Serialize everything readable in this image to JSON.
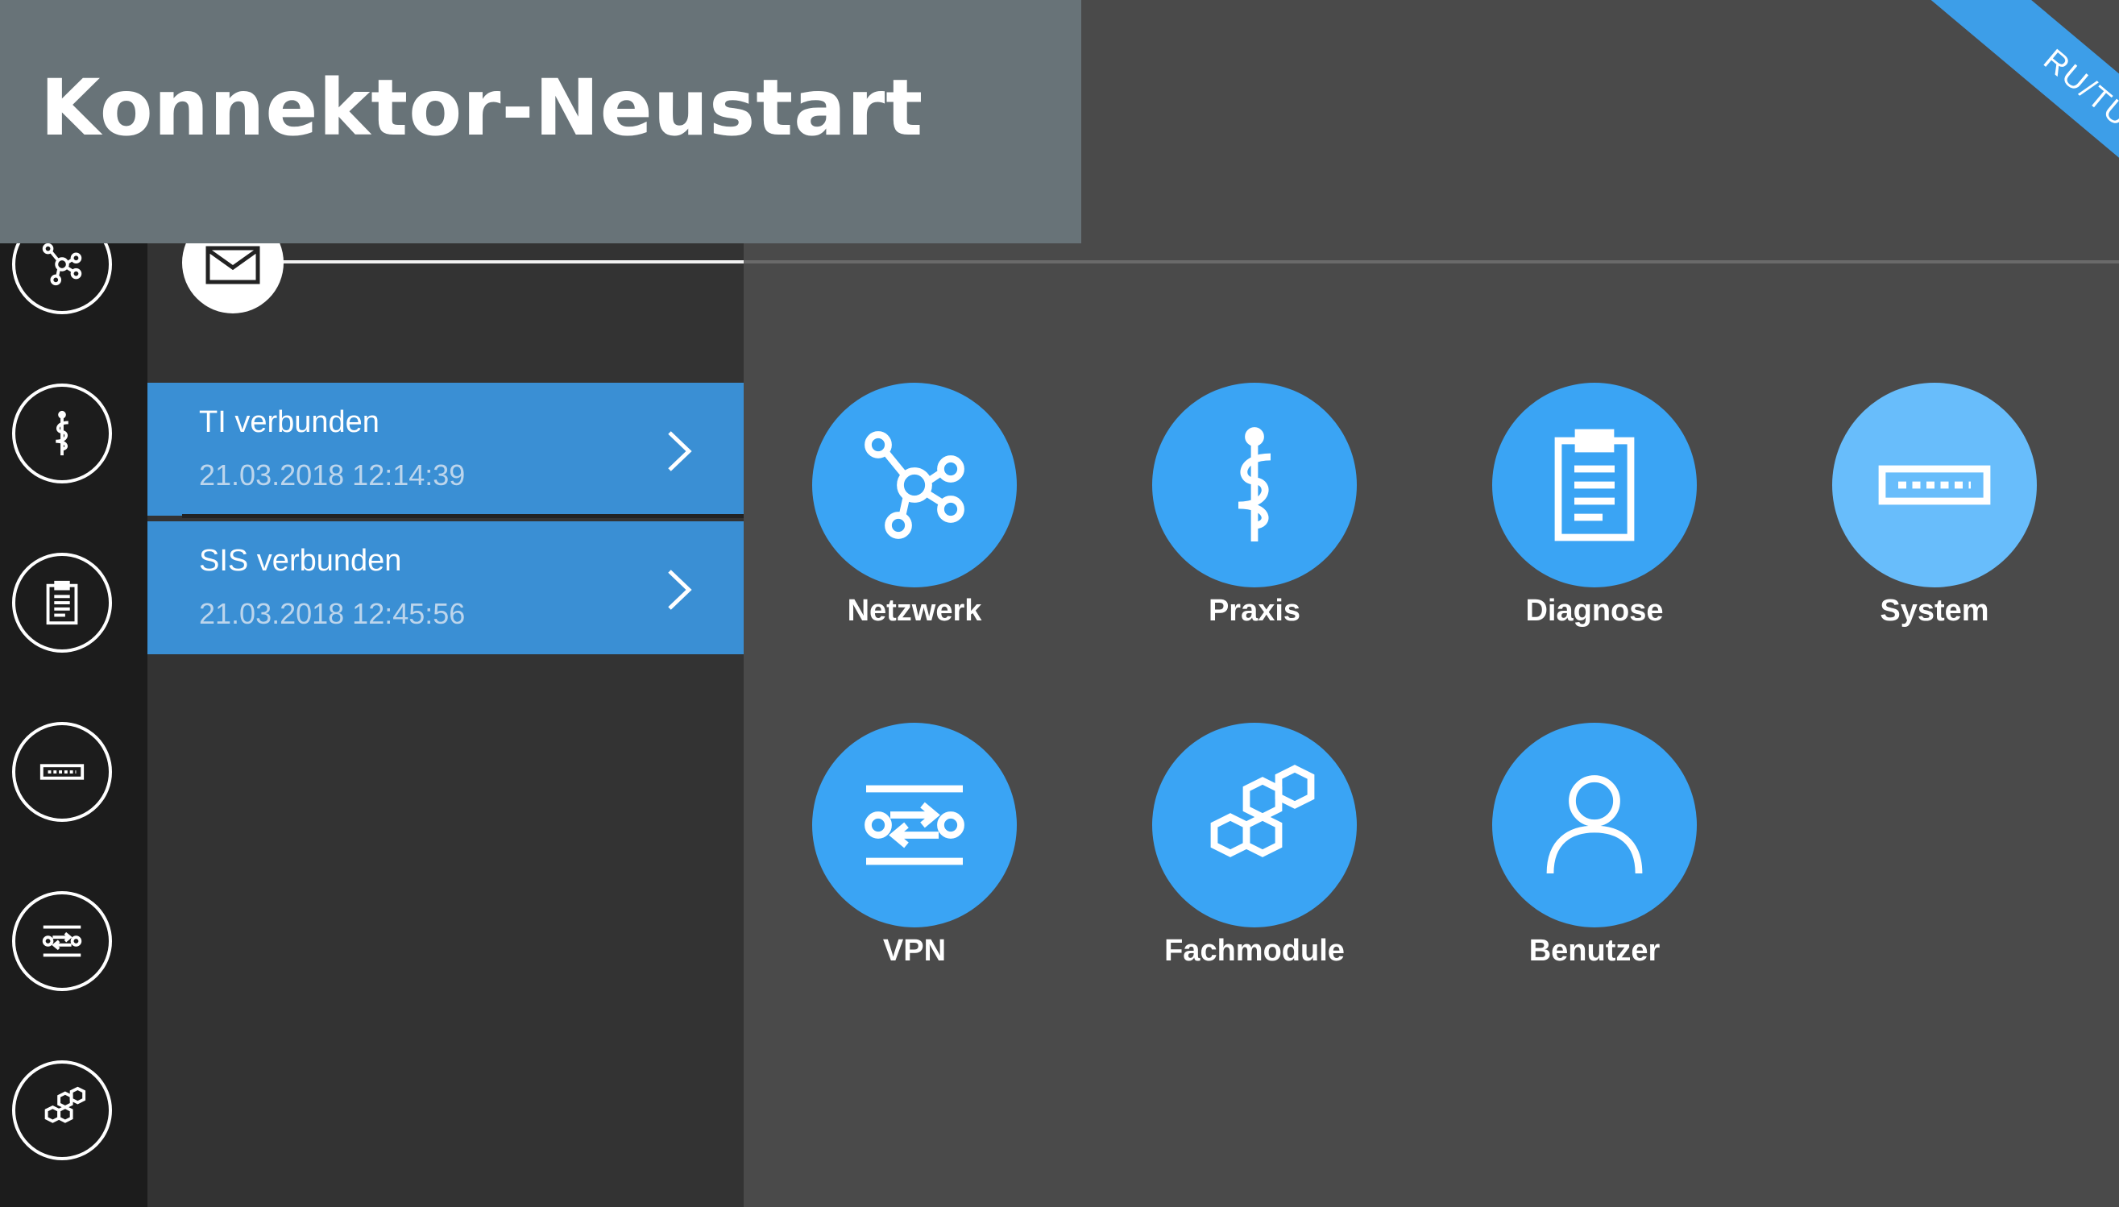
{
  "banner": {
    "title": "Konnektor-Neustart",
    "corner_label": "RU/TU"
  },
  "colors": {
    "accent": "#3aa4f4",
    "accent_light": "#68bdfb",
    "status_bg": "#3a8fd4",
    "sidebar_bg": "#1c1c1c",
    "panel_bg": "#333333",
    "main_bg": "#4a4a4a",
    "banner_bg": "#687378"
  },
  "sidebar": {
    "items": [
      {
        "icon": "network-icon"
      },
      {
        "icon": "caduceus-icon"
      },
      {
        "icon": "clipboard-icon"
      },
      {
        "icon": "device-icon"
      },
      {
        "icon": "vpn-icon"
      },
      {
        "icon": "hexagons-icon"
      }
    ]
  },
  "messages": {
    "icon": "envelope-icon"
  },
  "status": [
    {
      "title": "TI verbunden",
      "date": "21.03.2018 12:14:39"
    },
    {
      "title": "SIS verbunden",
      "date": "21.03.2018 12:45:56"
    }
  ],
  "tiles": [
    {
      "label": "Netzwerk",
      "icon": "network-icon"
    },
    {
      "label": "Praxis",
      "icon": "caduceus-icon"
    },
    {
      "label": "Diagnose",
      "icon": "clipboard-icon"
    },
    {
      "label": "System",
      "icon": "device-icon"
    },
    {
      "label": "VPN",
      "icon": "vpn-icon"
    },
    {
      "label": "Fachmodule",
      "icon": "hexagons-icon"
    },
    {
      "label": "Benutzer",
      "icon": "user-icon"
    }
  ]
}
